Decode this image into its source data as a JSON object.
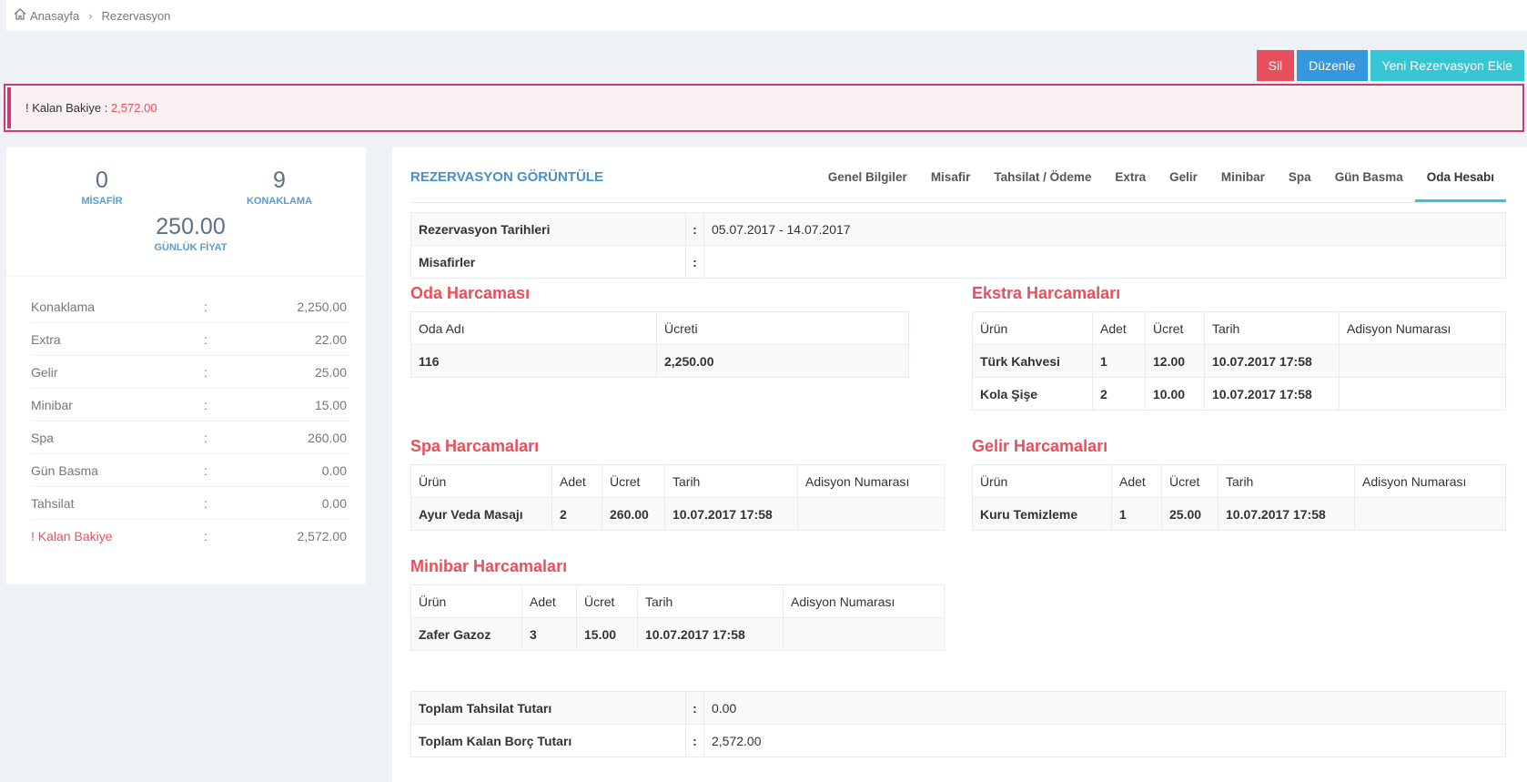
{
  "breadcrumb": {
    "home": "Anasayfa",
    "current": "Rezervasyon"
  },
  "actions": {
    "delete": "Sil",
    "edit": "Düzenle",
    "new": "Yeni Rezervasyon Ekle"
  },
  "alert": {
    "label": "! Kalan Bakiye :",
    "value": "2,572.00"
  },
  "stats": {
    "misafir": {
      "value": "0",
      "label": "MİSAFİR"
    },
    "konaklama": {
      "value": "9",
      "label": "KONAKLAMA"
    },
    "gunluk": {
      "value": "250.00",
      "label": "GÜNLÜK FİYAT"
    }
  },
  "summary": [
    {
      "label": "Konaklama",
      "colon": ":",
      "value": "2,250.00"
    },
    {
      "label": "Extra",
      "colon": ":",
      "value": "22.00"
    },
    {
      "label": "Gelir",
      "colon": ":",
      "value": "25.00"
    },
    {
      "label": "Minibar",
      "colon": ":",
      "value": "15.00"
    },
    {
      "label": "Spa",
      "colon": ":",
      "value": "260.00"
    },
    {
      "label": "Gün Basma",
      "colon": ":",
      "value": "0.00"
    },
    {
      "label": "Tahsilat",
      "colon": ":",
      "value": "0.00"
    },
    {
      "label": "! Kalan Bakiye",
      "colon": ":",
      "value": "2,572.00"
    }
  ],
  "main": {
    "title": "REZERVASYON GÖRÜNTÜLE",
    "tabs": [
      "Genel Bilgiler",
      "Misafir",
      "Tahsilat / Ödeme",
      "Extra",
      "Gelir",
      "Minibar",
      "Spa",
      "Gün Basma",
      "Oda Hesabı"
    ],
    "info": [
      {
        "label": "Rezervasyon Tarihleri",
        "colon": ":",
        "value": "05.07.2017 - 14.07.2017"
      },
      {
        "label": "Misafirler",
        "colon": ":",
        "value": ""
      }
    ],
    "oda": {
      "title": "Oda Harcaması",
      "headers": [
        "Oda Adı",
        "Ücreti"
      ],
      "rows": [
        [
          "116",
          "2,250.00"
        ]
      ]
    },
    "ekstra": {
      "title": "Ekstra Harcamaları",
      "headers": [
        "Ürün",
        "Adet",
        "Ücret",
        "Tarih",
        "Adisyon Numarası"
      ],
      "rows": [
        [
          "Türk Kahvesi",
          "1",
          "12.00",
          "10.07.2017 17:58",
          ""
        ],
        [
          "Kola Şişe",
          "2",
          "10.00",
          "10.07.2017 17:58",
          ""
        ]
      ]
    },
    "spa": {
      "title": "Spa Harcamaları",
      "headers": [
        "Ürün",
        "Adet",
        "Ücret",
        "Tarih",
        "Adisyon Numarası"
      ],
      "rows": [
        [
          "Ayur Veda Masajı",
          "2",
          "260.00",
          "10.07.2017 17:58",
          ""
        ]
      ]
    },
    "gelir": {
      "title": "Gelir Harcamaları",
      "headers": [
        "Ürün",
        "Adet",
        "Ücret",
        "Tarih",
        "Adisyon Numarası"
      ],
      "rows": [
        [
          "Kuru Temizleme",
          "1",
          "25.00",
          "10.07.2017 17:58",
          ""
        ]
      ]
    },
    "minibar": {
      "title": "Minibar Harcamaları",
      "headers": [
        "Ürün",
        "Adet",
        "Ücret",
        "Tarih",
        "Adisyon Numarası"
      ],
      "rows": [
        [
          "Zafer Gazoz",
          "3",
          "15.00",
          "10.07.2017 17:58",
          ""
        ]
      ]
    },
    "totals": [
      {
        "label": "Toplam Tahsilat Tutarı",
        "colon": ":",
        "value": "0.00"
      },
      {
        "label": "Toplam Kalan Borç Tutarı",
        "colon": ":",
        "value": "2,572.00"
      }
    ]
  },
  "colors": {
    "danger": "#e7505a",
    "primary": "#3598dc",
    "accent": "#36c6d3",
    "title_blue": "#4b8ec8"
  }
}
